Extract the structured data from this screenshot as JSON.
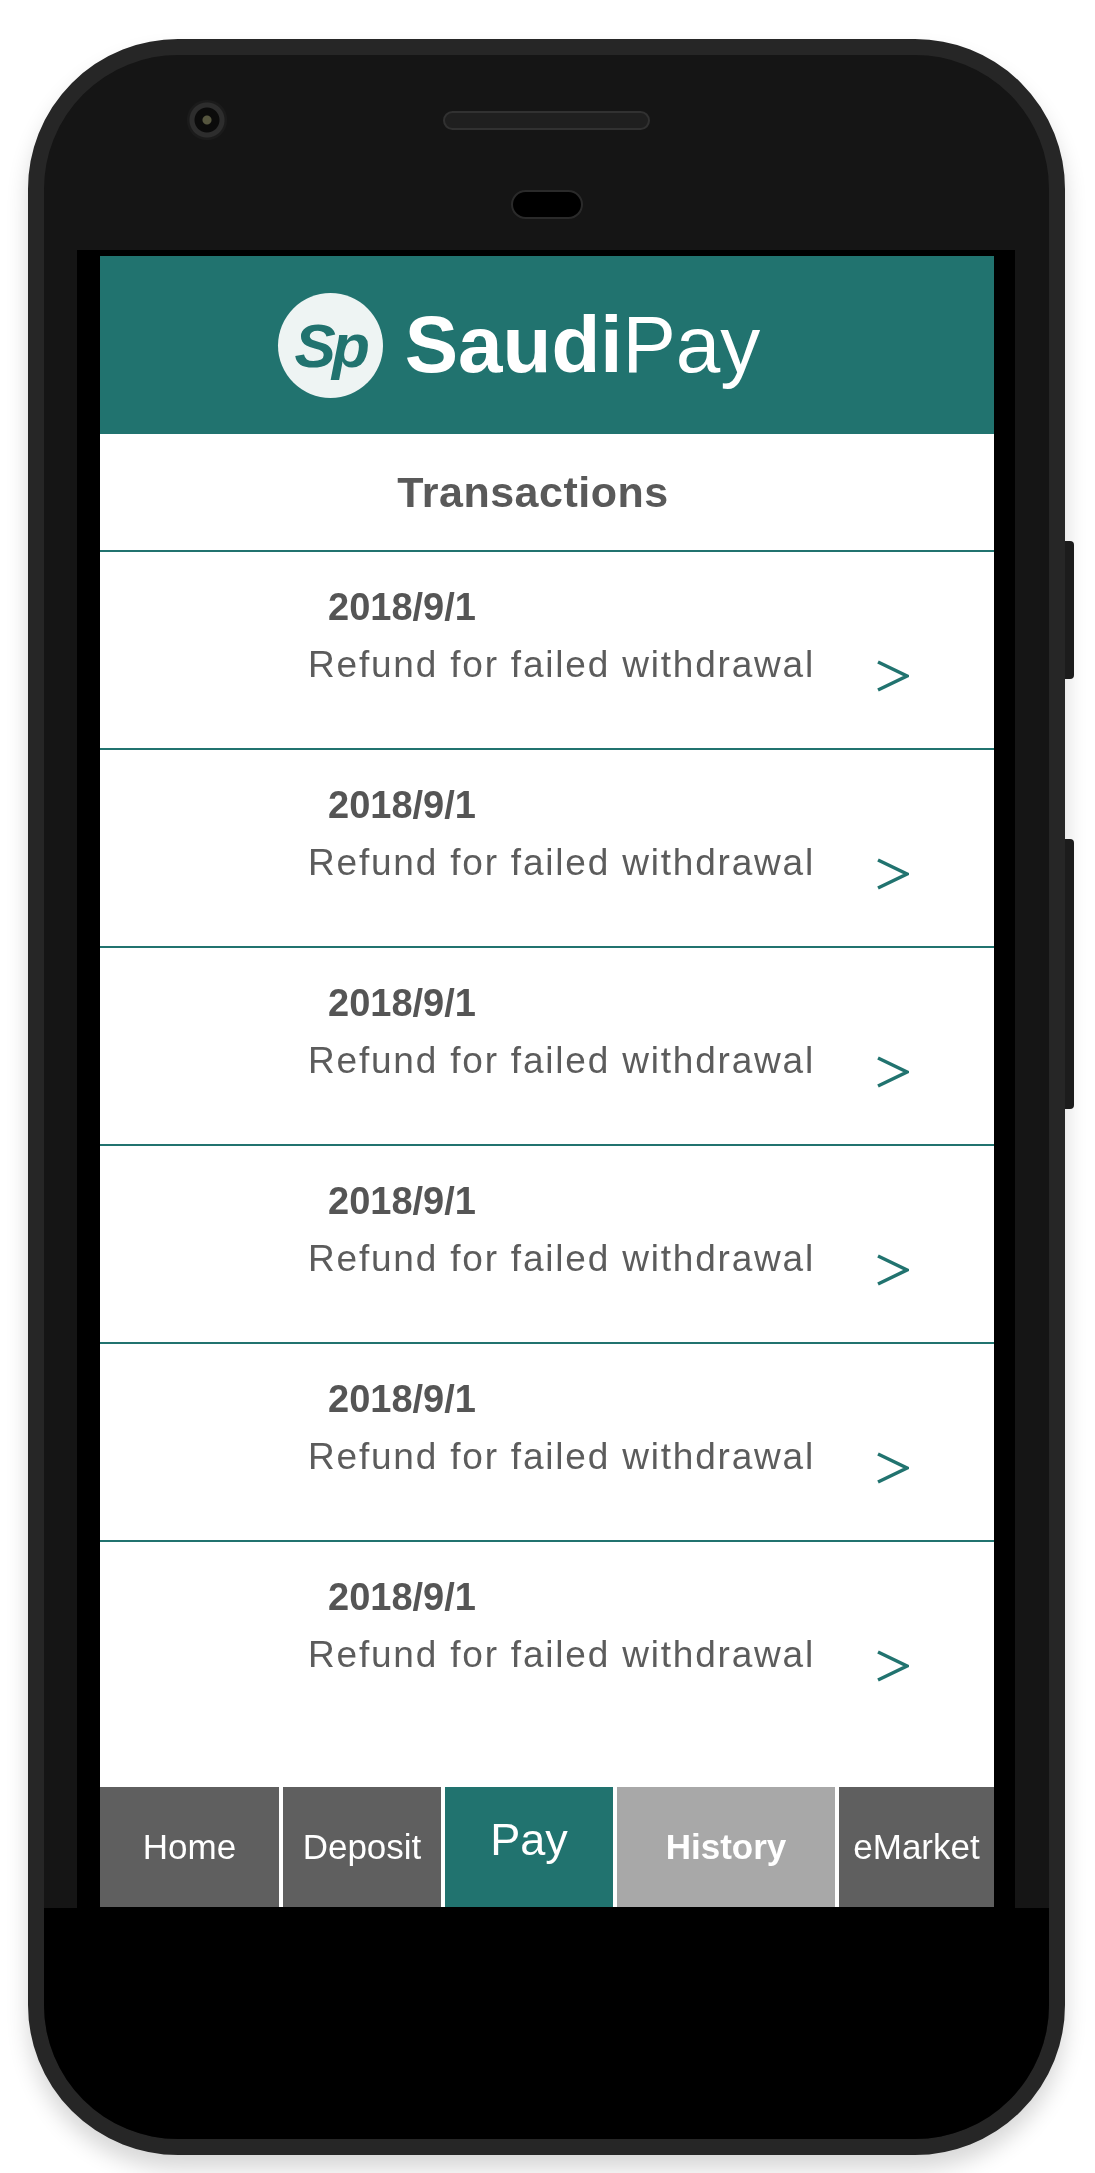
{
  "header": {
    "brand_mark": "Sp",
    "brand_name": "**Saudi**Pay"
  },
  "title": "Transactions",
  "transactions": [
    {
      "date": "2018/9/1",
      "description": "Refund for failed withdrawal"
    },
    {
      "date": "2018/9/1",
      "description": "Refund for failed withdrawal"
    },
    {
      "date": "2018/9/1",
      "description": "Refund for failed withdrawal"
    },
    {
      "date": "2018/9/1",
      "description": "Refund for failed withdrawal"
    },
    {
      "date": "2018/9/1",
      "description": "Refund for failed withdrawal"
    },
    {
      "date": "2018/9/1",
      "description": "Refund for failed withdrawal"
    }
  ],
  "nav": [
    {
      "label": "Home",
      "kind": "tab",
      "selected": false
    },
    {
      "label": "Deposit",
      "kind": "tab",
      "selected": false
    },
    {
      "label": "Pay",
      "kind": "action",
      "selected": false
    },
    {
      "label": "History",
      "kind": "tab",
      "selected": true
    },
    {
      "label": "eMarket",
      "kind": "tab",
      "selected": false
    }
  ]
}
